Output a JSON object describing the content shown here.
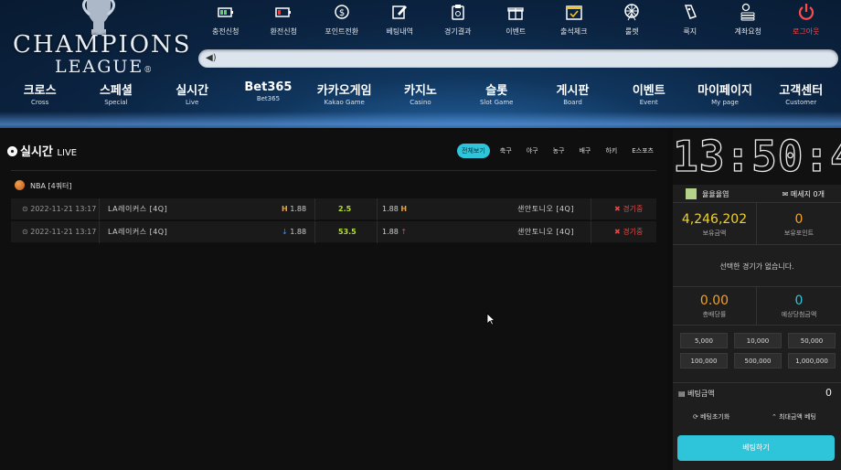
{
  "logo": {
    "line1": "CHAMPIONS",
    "line2": "LEAGUE",
    "trademark": "®"
  },
  "top_menu": [
    {
      "label": "충전신청",
      "icon": "battery-charge-icon"
    },
    {
      "label": "환전신청",
      "icon": "battery-low-icon"
    },
    {
      "label": "포인트전환",
      "icon": "exchange-icon"
    },
    {
      "label": "베팅내역",
      "icon": "edit-note-icon"
    },
    {
      "label": "경기결과",
      "icon": "clipboard-icon"
    },
    {
      "label": "이벤트",
      "icon": "gift-icon"
    },
    {
      "label": "출석체크",
      "icon": "calendar-check-icon"
    },
    {
      "label": "룰렛",
      "icon": "ferris-wheel-icon"
    },
    {
      "label": "룩지",
      "icon": "ticket-icon"
    },
    {
      "label": "계좌요청",
      "icon": "coins-icon"
    },
    {
      "label": "로그아웃",
      "icon": "power-icon"
    }
  ],
  "notice": {
    "icon": "speaker-icon",
    "text": ""
  },
  "main_nav": [
    {
      "ko": "크로스",
      "en": "Cross"
    },
    {
      "ko": "스페셜",
      "en": "Special"
    },
    {
      "ko": "실시간",
      "en": "Live"
    },
    {
      "ko": "Bet365",
      "en": "Bet365"
    },
    {
      "ko": "카카오게임",
      "en": "Kakao Game"
    },
    {
      "ko": "카지노",
      "en": "Casino"
    },
    {
      "ko": "슬롯",
      "en": "Slot Game"
    },
    {
      "ko": "게시판",
      "en": "Board"
    },
    {
      "ko": "이벤트",
      "en": "Event"
    },
    {
      "ko": "마이페이지",
      "en": "My page"
    },
    {
      "ko": "고객센터",
      "en": "Customer"
    }
  ],
  "live": {
    "title": "실시간",
    "title_suffix": "LIVE",
    "tabs": [
      "전체보기",
      "축구",
      "야구",
      "농구",
      "배구",
      "하키",
      "E스포츠"
    ],
    "active_tab": "전체보기",
    "league": "NBA [4쿼터]",
    "matches": [
      {
        "time": "2022-11-21 13:17",
        "home": "LA레이커스 [4Q]",
        "home_marker": "H",
        "home_odds": "1.88",
        "mid": "2.5",
        "away_odds": "1.88",
        "away_marker": "H",
        "away": "샌안토니오 [4Q]",
        "status": "경기중"
      },
      {
        "time": "2022-11-21 13:17",
        "home": "LA레이커스 [4Q]",
        "home_marker": "↓",
        "home_odds": "1.88",
        "mid": "53.5",
        "away_odds": "1.88",
        "away_marker": "↑",
        "away": "샌안토니오 [4Q]",
        "status": "경기중"
      }
    ]
  },
  "panel": {
    "clock": "13:50:40",
    "level": "율율율염",
    "message": "메세지 0개",
    "balance": {
      "value": "4,246,202",
      "label": "보유금액"
    },
    "points": {
      "value": "0",
      "label": "보유포인트"
    },
    "empty_text": "선택한 경기가 없습니다.",
    "total_odds": {
      "value": "0.00",
      "label": "총배당률"
    },
    "expected_win": {
      "value": "0",
      "label": "예상당첨금액"
    },
    "amounts": [
      "5,000",
      "10,000",
      "50,000",
      "100,000",
      "500,000",
      "1,000,000"
    ],
    "bet_amount_label": "베팅금액",
    "bet_amount_value": "0",
    "reset_label": "베팅초기화",
    "max_label": "최대금액 베팅",
    "bet_button": "베팅하기"
  },
  "colors": {
    "accent": "#2ec4d9",
    "balance": "#f0d22a",
    "odds": "#f5a022",
    "logout": "#ff4b4b",
    "status": "#e04848"
  }
}
